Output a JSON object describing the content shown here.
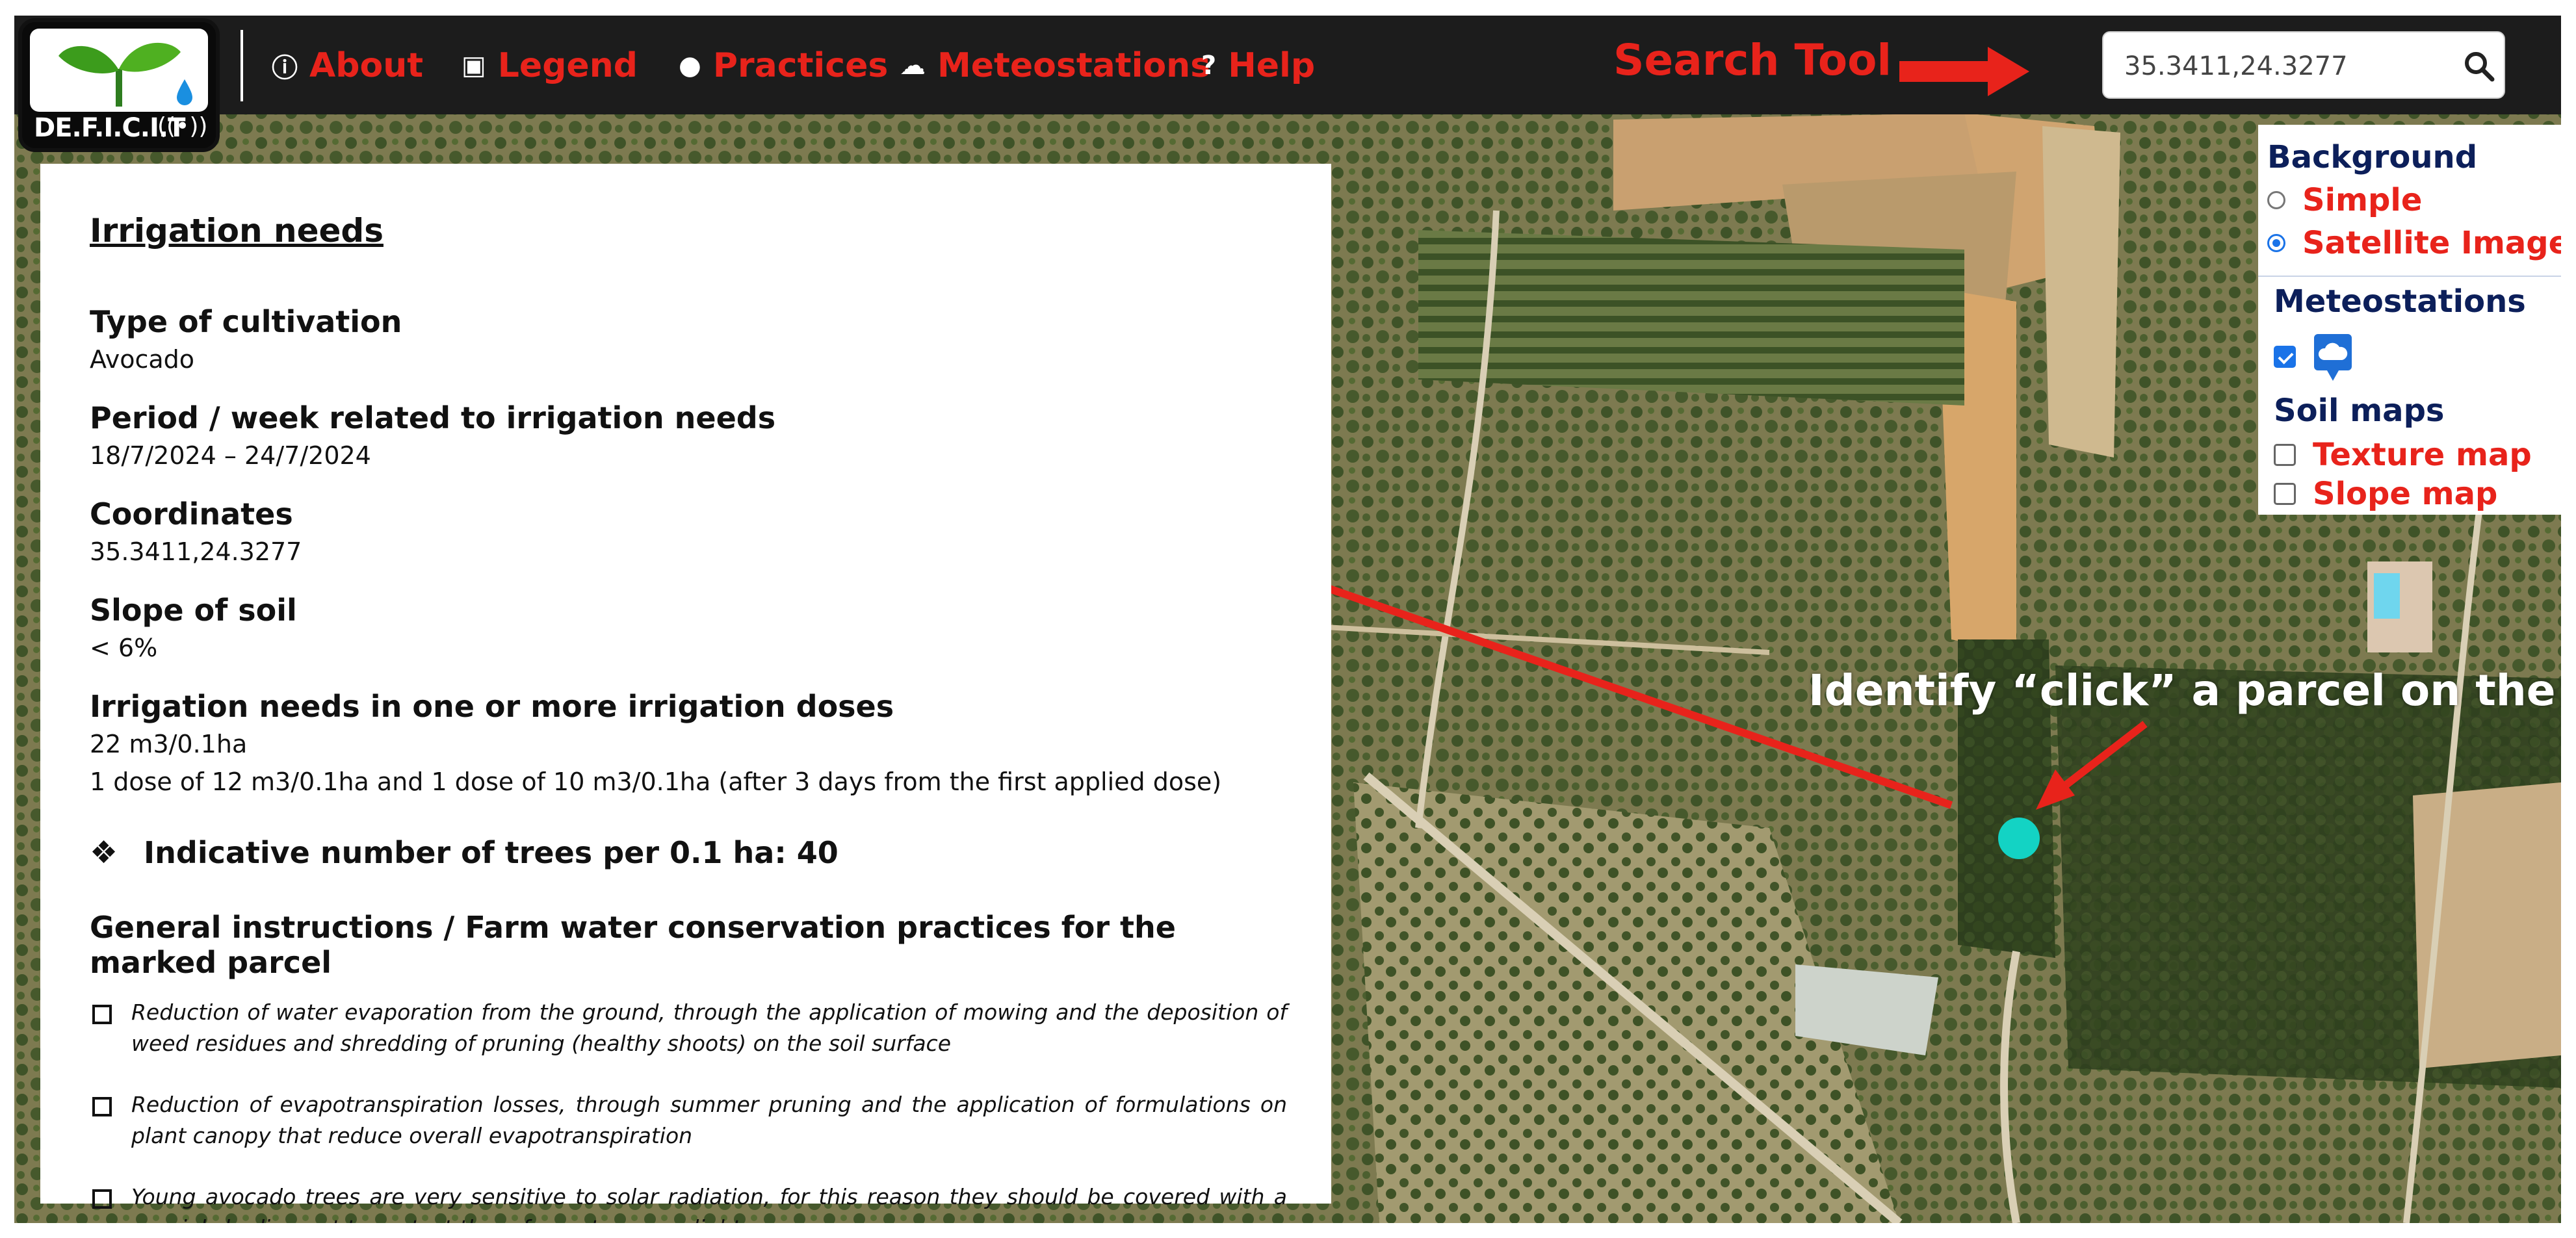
{
  "navbar": {
    "logo_text": "DE.F.I.C.I.T",
    "items": [
      {
        "label": "About",
        "icon": "info-icon"
      },
      {
        "label": "Legend",
        "icon": "image-icon"
      },
      {
        "label": "Practices",
        "icon": "drop-icon"
      },
      {
        "label": "Meteostations",
        "icon": "cloud-icon"
      },
      {
        "label": "Help",
        "icon": "help-icon"
      }
    ],
    "search_tool_label": "Search Tool",
    "search": {
      "value": "35.3411,24.3277",
      "icon": "search-icon"
    }
  },
  "info_panel": {
    "title": "Irrigation needs",
    "fields": [
      {
        "label": "Type of cultivation",
        "values": [
          "Avocado"
        ]
      },
      {
        "label": "Period / week related to irrigation needs",
        "values": [
          "18/7/2024 – 24/7/2024"
        ]
      },
      {
        "label": "Coordinates",
        "values": [
          "35.3411,24.3277"
        ]
      },
      {
        "label": "Slope of soil",
        "values": [
          "< 6%"
        ]
      },
      {
        "label": "Irrigation needs in one or more irrigation doses",
        "values": [
          "22 m3/0.1ha",
          "1 dose of 12 m3/0.1ha and 1 dose of 10 m3/0.1ha (after 3 days from the first applied dose)"
        ]
      }
    ],
    "trees_line": "Indicative number of trees per 0.1 ha: 40",
    "general_title": "General instructions / Farm water conservation practices for the marked parcel",
    "practices": [
      "Reduction of water evaporation from the ground, through the application of mowing and the deposition of weed residues and shredding of pruning (healthy shoots) on the soil surface",
      "Reduction of evapotranspiration losses, through summer pruning and the application of formulations on plant canopy that reduce overall evapotranspiration",
      "Young avocado trees are very sensitive to solar radiation, for this reason they should be covered with a special shading net to protect them from strong sunlight"
    ]
  },
  "layer_panel": {
    "background_title": "Background",
    "background_options": [
      {
        "label": "Simple",
        "selected": false
      },
      {
        "label": "Satellite Image",
        "selected": true
      }
    ],
    "meteostations_title": "Meteostations",
    "meteostations_checked": true,
    "meteostation_icon": "cloud-pin-icon",
    "soil_title": "Soil maps",
    "soil_options": [
      {
        "label": "Texture map",
        "checked": false
      },
      {
        "label": "Slope map",
        "checked": false
      }
    ]
  },
  "annotations": {
    "identify_label": "Identify “click” a parcel on the map"
  },
  "colors": {
    "navbar_bg": "#1c1c1c",
    "accent_red": "#e8231b",
    "navy": "#0c1f5a",
    "marker": "#13d3c4",
    "checkbox_blue": "#1a73e8"
  }
}
